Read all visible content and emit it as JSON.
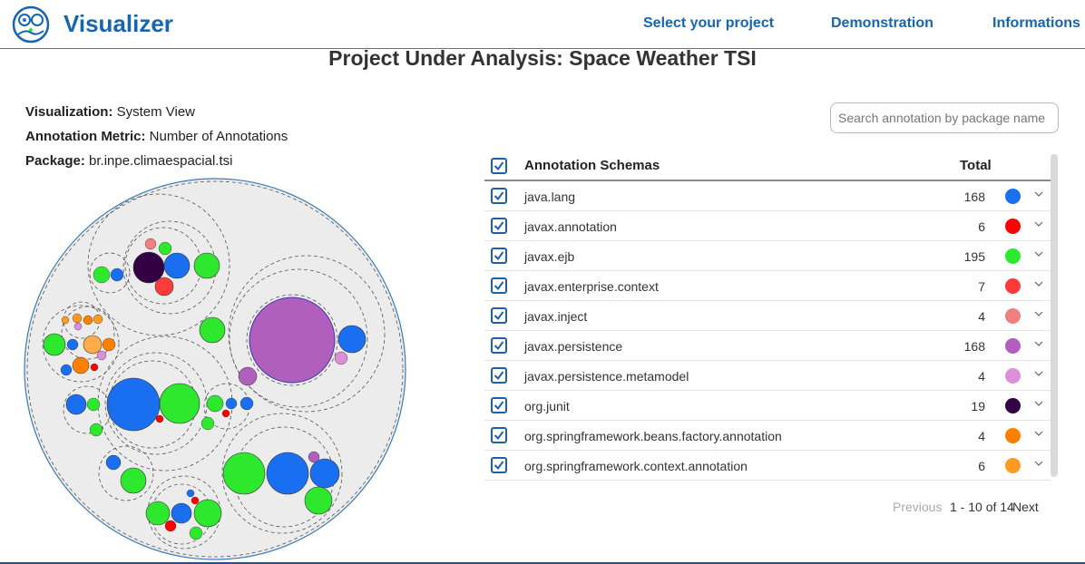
{
  "navbar": {
    "brand": "Visualizer",
    "links": [
      "Select your project",
      "Demonstration",
      "Informations"
    ]
  },
  "page_title": "Project Under Analysis: Space Weather TSI",
  "info": {
    "visualization_label": "Visualization:",
    "visualization_value": "System View",
    "metric_label": "Annotation Metric:",
    "metric_value": "Number of Annotations",
    "package_label": "Package:",
    "package_value": "br.inpe.climaespacial.tsi"
  },
  "search": {
    "placeholder": "Search annotation by package name",
    "value": ""
  },
  "table": {
    "header_name": "Annotation Schemas",
    "header_total": "Total",
    "rows": [
      {
        "name": "java.lang",
        "total": "168",
        "color": "#1a6ef0"
      },
      {
        "name": "javax.annotation",
        "total": "6",
        "color": "#ff0000"
      },
      {
        "name": "javax.ejb",
        "total": "195",
        "color": "#2ee82e"
      },
      {
        "name": "javax.enterprise.context",
        "total": "7",
        "color": "#ff3a3a"
      },
      {
        "name": "javax.inject",
        "total": "4",
        "color": "#f08080"
      },
      {
        "name": "javax.persistence",
        "total": "168",
        "color": "#b05fbd"
      },
      {
        "name": "javax.persistence.metamodel",
        "total": "4",
        "color": "#dd90d8"
      },
      {
        "name": "org.junit",
        "total": "19",
        "color": "#330044"
      },
      {
        "name": "org.springframework.beans.factory.annotation",
        "total": "4",
        "color": "#ff8000"
      },
      {
        "name": "org.springframework.context.annotation",
        "total": "6",
        "color": "#ff9a20"
      }
    ]
  },
  "pagination": {
    "previous": "Previous",
    "range": "1 - 10 of 14",
    "next": "Next"
  },
  "colors": {
    "brand": "#1565b0",
    "checkbox": "#1f5fa8",
    "circle_fill": "#ececec",
    "outer_border": "#3a7ab5"
  }
}
